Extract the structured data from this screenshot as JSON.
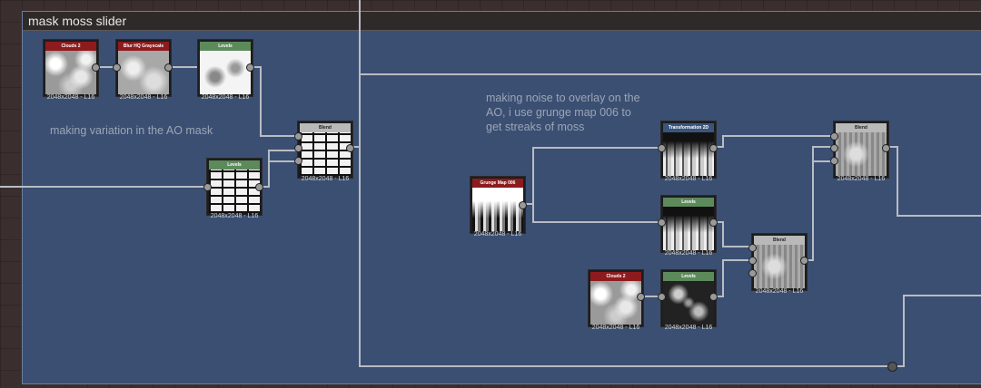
{
  "frame": {
    "title": "mask moss slider"
  },
  "comments": {
    "ao_variation": "making variation in the AO mask",
    "noise_overlay": "making noise to overlay on the AO, i use grunge map 006 to get streaks of moss"
  },
  "nodes": {
    "clouds2_a": {
      "title": "Clouds 2",
      "resolution": "2048x2048 - L16"
    },
    "blur_hq": {
      "title": "Blur HQ Grayscale",
      "resolution": "2048x2048 - L16"
    },
    "levels_a": {
      "title": "Levels",
      "resolution": "2048x2048 - L16"
    },
    "levels_b": {
      "title": "Levels",
      "resolution": "2048x2048 - L16"
    },
    "blend_a": {
      "title": "Blend",
      "resolution": "2048x2048 - L16"
    },
    "grunge_map": {
      "title": "Grunge Map 006",
      "resolution": "2048x2048 - L16"
    },
    "transform_2d": {
      "title": "Transformation 2D",
      "resolution": "2048x2048 - L16"
    },
    "levels_c": {
      "title": "Levels",
      "resolution": "2048x2048 - L16"
    },
    "blend_b": {
      "title": "Blend",
      "resolution": "2048x2048 - L16"
    },
    "clouds2_b": {
      "title": "Clouds 2",
      "resolution": "2048x2048 - L16"
    },
    "levels_d": {
      "title": "Levels",
      "resolution": "2048x2048 - L16"
    },
    "blend_c": {
      "title": "Blend",
      "resolution": "2048x2048 - L16"
    }
  },
  "colors": {
    "frame_bg": "#3b4f72",
    "header_red": "#8d1b1e",
    "header_green": "#5d8a5b",
    "header_blue": "#3a557c",
    "header_gray": "#b9b9b9",
    "wire": "#b8bcc4"
  }
}
